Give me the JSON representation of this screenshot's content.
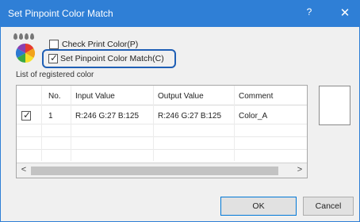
{
  "window": {
    "title": "Set Pinpoint Color Match",
    "help_glyph": "?",
    "close_glyph": "✕"
  },
  "options": {
    "check_print_color": {
      "label": "Check Print Color(P)",
      "checked": false
    },
    "set_pinpoint_color_match": {
      "label": "Set Pinpoint Color Match(C)",
      "checked": true
    }
  },
  "registered_list": {
    "caption": "List of registered color",
    "columns": [
      "No.",
      "Input Value",
      "Output Value",
      "Comment"
    ],
    "rows": [
      {
        "checked": true,
        "no": "1",
        "input": "R:246 G:27 B:125",
        "output": "R:246 G:27 B:125",
        "comment": "Color_A"
      }
    ]
  },
  "scrollbar": {
    "left_glyph": "<",
    "right_glyph": ">"
  },
  "buttons": {
    "ok": "OK",
    "cancel": "Cancel"
  },
  "colors": {
    "titlebar": "#2f7fd6",
    "highlight": "#1f5fb5"
  }
}
